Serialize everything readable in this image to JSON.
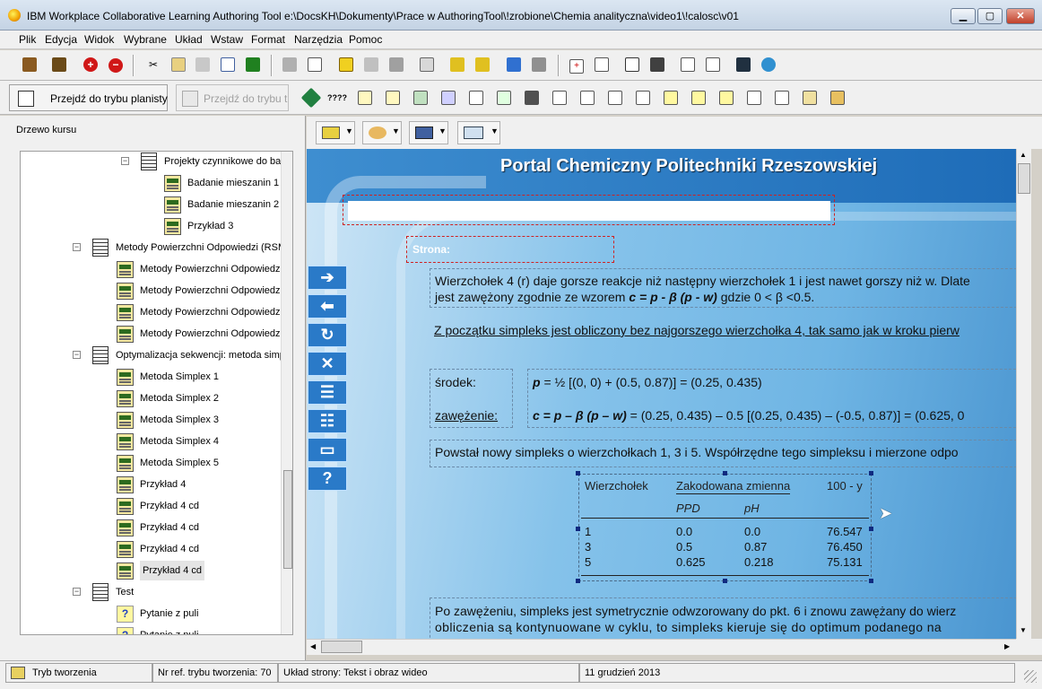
{
  "window": {
    "title": "IBM Workplace Collaborative Learning Authoring Tool   e:\\DocsKH\\Dokumenty\\Prace w AuthoringTool\\!zrobione\\Chemia analityczna\\video1\\!calosc\\v01"
  },
  "menu": [
    "Plik",
    "Edycja",
    "Widok",
    "Wybrane",
    "Układ",
    "Wstaw",
    "Format",
    "Narzędzia",
    "Pomoc"
  ],
  "toolbar2": {
    "planist_button": "Przejdź do trybu planisty",
    "trainer_button": "Przejdź do trybu t"
  },
  "tree": {
    "label": "Drzewo kursu",
    "items": [
      {
        "text": "Projekty czynnikowe do ba",
        "type": "book",
        "level": 2,
        "expander": "−"
      },
      {
        "text": "Badanie mieszanin 1",
        "type": "page",
        "level": 3
      },
      {
        "text": "Badanie mieszanin 2",
        "type": "page",
        "level": 3
      },
      {
        "text": "Przykład 3",
        "type": "page",
        "level": 3
      },
      {
        "text": "Metody Powierzchni Odpowiedzi (RSM",
        "type": "book",
        "level": 1,
        "expander": "−"
      },
      {
        "text": "Metody Powierzchni Odpowiedzi",
        "type": "page",
        "level": 2
      },
      {
        "text": "Metody Powierzchni Odpowiedzi",
        "type": "page",
        "level": 2
      },
      {
        "text": "Metody Powierzchni Odpowiedzi",
        "type": "page",
        "level": 2
      },
      {
        "text": "Metody Powierzchni Odpowiedzi",
        "type": "page",
        "level": 2
      },
      {
        "text": "Optymalizacja sekwencji: metoda simp",
        "type": "book",
        "level": 1,
        "expander": "−"
      },
      {
        "text": "Metoda Simplex 1",
        "type": "page",
        "level": 2
      },
      {
        "text": "Metoda Simplex 2",
        "type": "page",
        "level": 2
      },
      {
        "text": "Metoda Simplex 3",
        "type": "page",
        "level": 2
      },
      {
        "text": "Metoda Simplex 4",
        "type": "page",
        "level": 2
      },
      {
        "text": "Metoda Simplex 5",
        "type": "page",
        "level": 2
      },
      {
        "text": "Przykład 4",
        "type": "page",
        "level": 2
      },
      {
        "text": "Przykład 4 cd",
        "type": "page",
        "level": 2
      },
      {
        "text": "Przykład 4 cd",
        "type": "page",
        "level": 2
      },
      {
        "text": "Przykład 4 cd",
        "type": "page",
        "level": 2
      },
      {
        "text": "Przykład 4 cd",
        "type": "page",
        "level": 2,
        "selected": true
      },
      {
        "text": "Test",
        "type": "book",
        "level": 1,
        "expander": "−"
      },
      {
        "text": "Pytanie z puli",
        "type": "question",
        "level": 2
      },
      {
        "text": "Pytanie z puli",
        "type": "question",
        "level": 2
      }
    ]
  },
  "content": {
    "portal_title": "Portal Chemiczny Politechniki Rzeszowskiej",
    "strona_label": "Strona:",
    "p1_line1": "Wierzchołek 4 (r) daje gorsze reakcje niż następny wierzchołek 1 i jest nawet gorszy niż w. Dlate",
    "p1_line2_a": "jest zawężony zgodnie ze wzorem ",
    "p1_formula": "c = p - β (p - w)",
    "p1_line2_b": " gdzie 0 < β <0.5.",
    "p2": "Z początku simpleks jest obliczony bez najgorszego wierzchołka 4, tak samo jak w kroku pierw",
    "srodek_label": "środek:",
    "zawezenie_label": "zawężenie:",
    "srodek_formula_a": "p",
    "srodek_formula_b": " = ½ [(0, 0) + (0.5, 0.87)] = (0.25, 0.435)",
    "zaw_formula_a": "c = p – β (p – w)",
    "zaw_formula_b": " = (0.25, 0.435) – 0.5 [(0.25, 0.435) – (-0.5, 0.87)] = (0.625, 0",
    "p3": "Powstał nowy simpleks o wierzchołkach 1, 3 i 5. Współrzędne tego simpleksu i mierzone odpo",
    "table": {
      "h1": "Wierzchołek",
      "h2": "Zakodowana zmienna",
      "h3": "100 - y",
      "s1": "PPD",
      "s2": "pH",
      "rows": [
        [
          "1",
          "0.0",
          "0.0",
          "76.547"
        ],
        [
          "3",
          "0.5",
          "0.87",
          "76.450"
        ],
        [
          "5",
          "0.625",
          "0.218",
          "75.131"
        ]
      ]
    },
    "p4_line1": "Po zawężeniu, simpleks jest symetrycznie odwzorowany do pkt. 6 i znowu zawężany do wierz",
    "p4_line2": "obliczenia są kontynuowane w cyklu, to simpleks kieruje się do optimum podanego na"
  },
  "status": {
    "mode": "Tryb tworzenia",
    "ref": "Nr ref. trybu tworzenia: 70",
    "layout": "Układ strony: Tekst i obraz wideo",
    "date": "11 grudzień 2013"
  }
}
